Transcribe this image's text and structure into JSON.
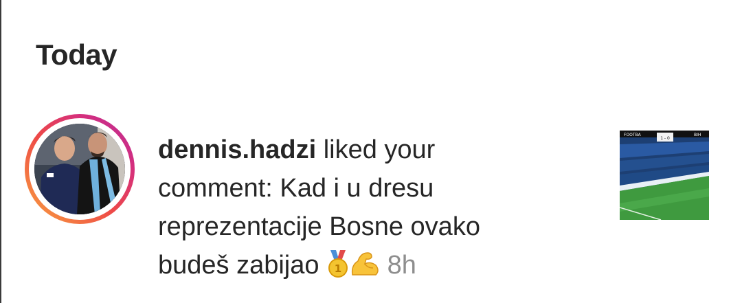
{
  "section": {
    "heading": "Today"
  },
  "notification": {
    "username": "dennis.hadzi",
    "action_text": " liked your comment: Kad i u dresu reprezentacije Bosne ovako budeš zabijao ",
    "emojis": [
      "medal-icon",
      "flexed-biceps-icon"
    ],
    "time": "8h",
    "avatar": "avatar-photo-two-people",
    "post_thumbnail": "football-stadium-broadcast",
    "thumbnail_overlay": {
      "left_label": "FOOTBA",
      "score": "1 - 0",
      "right_label": "BIH"
    }
  },
  "colors": {
    "text": "#262626",
    "muted": "#8e8e8e",
    "ring_start": "#f9a53f",
    "ring_end": "#b62b9c"
  }
}
